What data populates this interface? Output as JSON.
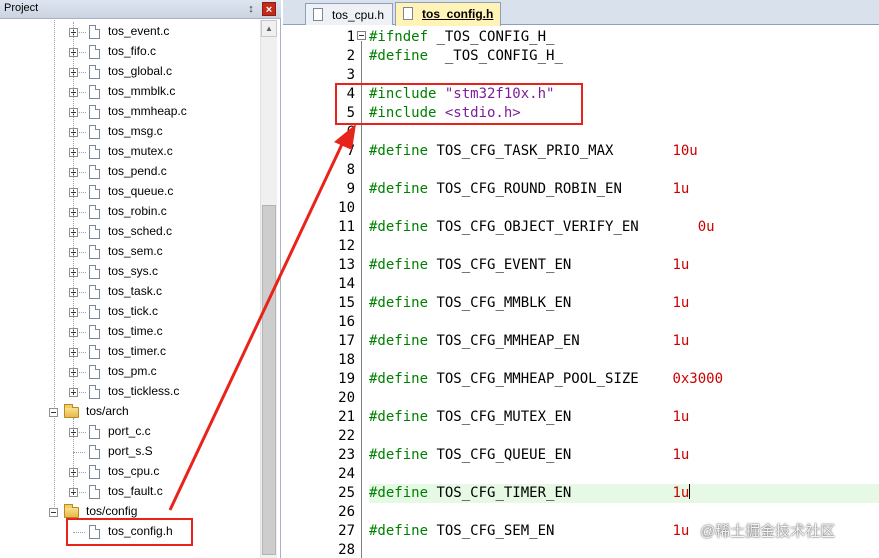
{
  "project_panel": {
    "title": "Project",
    "pin_glyph": "↕",
    "close_glyph": "×",
    "files_kernel": [
      "tos_event.c",
      "tos_fifo.c",
      "tos_global.c",
      "tos_mmblk.c",
      "tos_mmheap.c",
      "tos_msg.c",
      "tos_mutex.c",
      "tos_pend.c",
      "tos_queue.c",
      "tos_robin.c",
      "tos_sched.c",
      "tos_sem.c",
      "tos_sys.c",
      "tos_task.c",
      "tos_tick.c",
      "tos_time.c",
      "tos_timer.c",
      "tos_pm.c",
      "tos_tickless.c"
    ],
    "group_arch": "tos/arch",
    "files_arch": [
      "port_c.c",
      "port_s.S",
      "tos_cpu.c",
      "tos_fault.c"
    ],
    "group_config": "tos/config",
    "files_config": [
      "tos_config.h"
    ],
    "scroll_up_glyph": "▲"
  },
  "editor": {
    "tabs": [
      {
        "label": "tos_cpu.h",
        "active": false
      },
      {
        "label": "tos_config.h",
        "active": true
      }
    ],
    "lines": [
      {
        "n": "1",
        "parts": [
          {
            "t": "#ifndef",
            "c": "pp"
          },
          {
            "t": " _TOS_CONFIG_H_",
            "c": "macro"
          }
        ]
      },
      {
        "n": "2",
        "parts": [
          {
            "t": "#define",
            "c": "pp"
          },
          {
            "t": "  _TOS_CONFIG_H_",
            "c": "macro"
          }
        ]
      },
      {
        "n": "3",
        "parts": []
      },
      {
        "n": "4",
        "parts": [
          {
            "t": "#include ",
            "c": "pp"
          },
          {
            "t": "\"stm32f10x.h\"",
            "c": "hdr"
          }
        ]
      },
      {
        "n": "5",
        "parts": [
          {
            "t": "#include ",
            "c": "pp"
          },
          {
            "t": "<stdio.h>",
            "c": "hdr"
          }
        ]
      },
      {
        "n": "6",
        "parts": []
      },
      {
        "n": "7",
        "parts": [
          {
            "t": "#define",
            "c": "pp"
          },
          {
            "t": " TOS_CFG_TASK_PRIO_MAX       ",
            "c": "macro"
          },
          {
            "t": "10u",
            "c": "num"
          }
        ]
      },
      {
        "n": "8",
        "parts": []
      },
      {
        "n": "9",
        "parts": [
          {
            "t": "#define",
            "c": "pp"
          },
          {
            "t": " TOS_CFG_ROUND_ROBIN_EN      ",
            "c": "macro"
          },
          {
            "t": "1u",
            "c": "num"
          }
        ]
      },
      {
        "n": "10",
        "parts": []
      },
      {
        "n": "11",
        "parts": [
          {
            "t": "#define",
            "c": "pp"
          },
          {
            "t": " TOS_CFG_OBJECT_VERIFY_EN       ",
            "c": "macro"
          },
          {
            "t": "0u",
            "c": "num"
          }
        ]
      },
      {
        "n": "12",
        "parts": []
      },
      {
        "n": "13",
        "parts": [
          {
            "t": "#define",
            "c": "pp"
          },
          {
            "t": " TOS_CFG_EVENT_EN            ",
            "c": "macro"
          },
          {
            "t": "1u",
            "c": "num"
          }
        ]
      },
      {
        "n": "14",
        "parts": []
      },
      {
        "n": "15",
        "parts": [
          {
            "t": "#define",
            "c": "pp"
          },
          {
            "t": " TOS_CFG_MMBLK_EN            ",
            "c": "macro"
          },
          {
            "t": "1u",
            "c": "num"
          }
        ]
      },
      {
        "n": "16",
        "parts": []
      },
      {
        "n": "17",
        "parts": [
          {
            "t": "#define",
            "c": "pp"
          },
          {
            "t": " TOS_CFG_MMHEAP_EN           ",
            "c": "macro"
          },
          {
            "t": "1u",
            "c": "num"
          }
        ]
      },
      {
        "n": "18",
        "parts": []
      },
      {
        "n": "19",
        "parts": [
          {
            "t": "#define",
            "c": "pp"
          },
          {
            "t": " TOS_CFG_MMHEAP_POOL_SIZE    ",
            "c": "macro"
          },
          {
            "t": "0x3000",
            "c": "num"
          }
        ]
      },
      {
        "n": "20",
        "parts": []
      },
      {
        "n": "21",
        "parts": [
          {
            "t": "#define",
            "c": "pp"
          },
          {
            "t": " TOS_CFG_MUTEX_EN            ",
            "c": "macro"
          },
          {
            "t": "1u",
            "c": "num"
          }
        ]
      },
      {
        "n": "22",
        "parts": []
      },
      {
        "n": "23",
        "parts": [
          {
            "t": "#define",
            "c": "pp"
          },
          {
            "t": " TOS_CFG_QUEUE_EN            ",
            "c": "macro"
          },
          {
            "t": "1u",
            "c": "num"
          }
        ]
      },
      {
        "n": "24",
        "parts": []
      },
      {
        "n": "25",
        "parts": [
          {
            "t": "#define",
            "c": "pp"
          },
          {
            "t": " TOS_CFG_TIMER_EN            ",
            "c": "macro"
          },
          {
            "t": "1u",
            "c": "num"
          }
        ]
      },
      {
        "n": "26",
        "parts": []
      },
      {
        "n": "27",
        "parts": [
          {
            "t": "#define",
            "c": "pp"
          },
          {
            "t": " TOS_CFG_SEM_EN              ",
            "c": "macro"
          },
          {
            "t": "1u",
            "c": "num"
          }
        ]
      },
      {
        "n": "28",
        "parts": []
      }
    ],
    "current_line": "25"
  },
  "colors": {
    "annotation": "#e8231a",
    "current_line_bg": "#e5f9e5"
  },
  "watermark": "@稀土掘金技术社区"
}
